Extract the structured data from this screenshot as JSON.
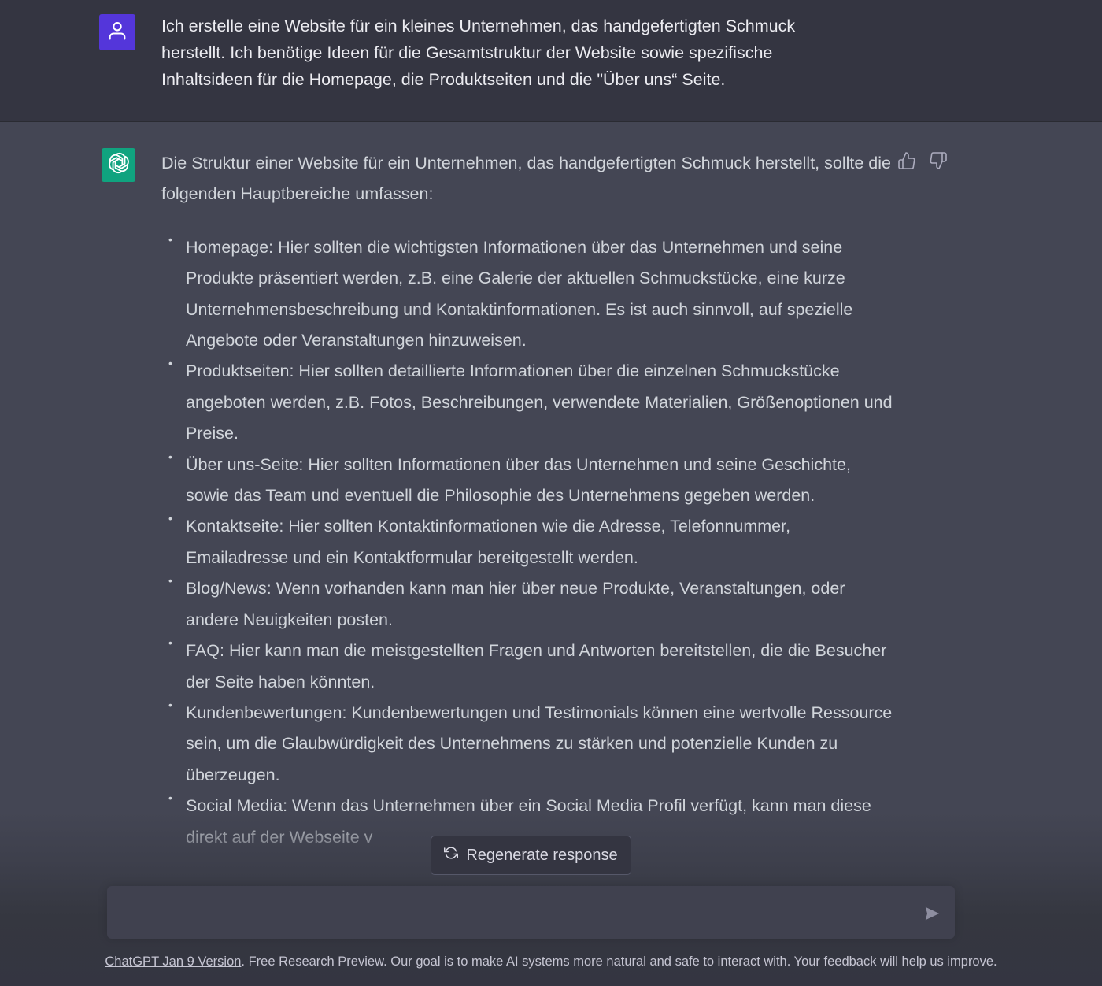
{
  "user_message": {
    "text": "Ich erstelle eine Website für ein kleines Unternehmen, das handgefertigten Schmuck herstellt. Ich benötige Ideen für die Gesamtstruktur der Website sowie spezifische Inhaltsideen für die Homepage, die Produktseiten und die \"Über uns“ Seite."
  },
  "assistant_message": {
    "intro": "Die Struktur einer Website für ein Unternehmen, das handgefertigten Schmuck herstellt, sollte die folgenden Hauptbereiche umfassen:",
    "bullets": [
      "Homepage: Hier sollten die wichtigsten Informationen über das Unternehmen und seine Produkte präsentiert werden, z.B. eine Galerie der aktuellen Schmuckstücke, eine kurze Unternehmensbeschreibung und Kontaktinformationen. Es ist auch sinnvoll, auf spezielle Angebote oder Veranstaltungen hinzuweisen.",
      "Produktseiten: Hier sollten detaillierte Informationen über die einzelnen Schmuckstücke angeboten werden, z.B. Fotos, Beschreibungen, verwendete Materialien, Größenoptionen und Preise.",
      "Über uns-Seite: Hier sollten Informationen über das Unternehmen und seine Geschichte, sowie das Team und eventuell die Philosophie des Unternehmens gegeben werden.",
      "Kontaktseite: Hier sollten Kontaktinformationen wie die Adresse, Telefonnummer, Emailadresse und ein Kontaktformular bereitgestellt werden.",
      "Blog/News: Wenn vorhanden kann man hier über neue Produkte, Veranstaltungen, oder andere Neuigkeiten posten.",
      "FAQ: Hier kann man die meistgestellten Fragen und Antworten bereitstellen, die die Besucher der Seite haben könnten.",
      "Kundenbewertungen: Kundenbewertungen und Testimonials können eine wertvolle Ressource sein, um die Glaubwürdigkeit des Unternehmens zu stärken und potenzielle Kunden zu überzeugen.",
      "Social Media: Wenn das Unternehmen über ein Social Media Profil verfügt, kann man diese direkt auf der Webseite v"
    ]
  },
  "regenerate_label": "Regenerate response",
  "input": {
    "placeholder": ""
  },
  "footer": {
    "link_text": "ChatGPT Jan 9 Version",
    "text": ". Free Research Preview. Our goal is to make AI systems more natural and safe to interact with. Your feedback will help us improve."
  },
  "icons": {
    "user_avatar": "user-icon",
    "assistant_avatar": "openai-logo-icon",
    "thumbs_up": "thumbs-up-icon",
    "thumbs_down": "thumbs-down-icon",
    "regenerate": "refresh-icon",
    "send": "send-icon"
  },
  "colors": {
    "user_avatar_bg": "#5436da",
    "assistant_avatar_bg": "#10a37f",
    "user_row_bg": "#343541",
    "assistant_row_bg": "#444654"
  }
}
